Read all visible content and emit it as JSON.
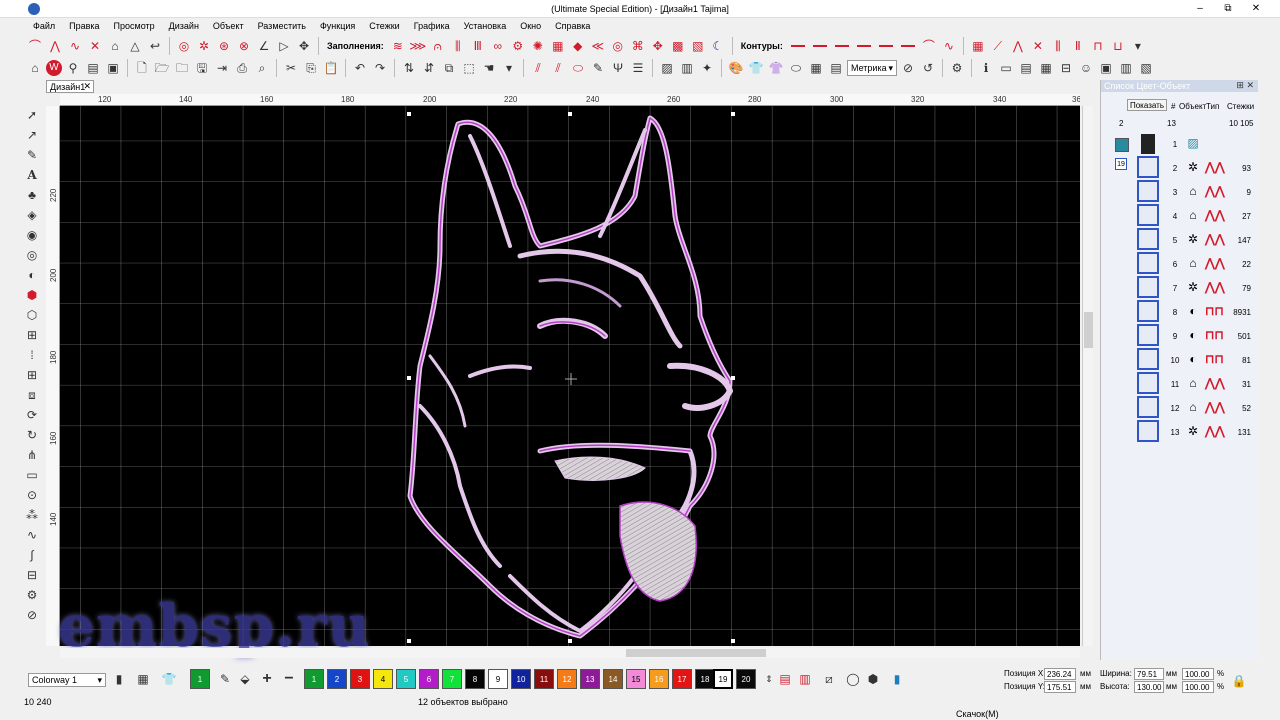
{
  "window": {
    "title": "(Ultimate Special Edition) - [Дизайн1       Tajima]",
    "minimize": "–",
    "restore": "⧉",
    "close": "✕"
  },
  "menu": [
    "Файл",
    "Правка",
    "Просмотр",
    "Дизайн",
    "Объект",
    "Разместить",
    "Функция",
    "Стежки",
    "Графика",
    "Установка",
    "Окно",
    "Справка"
  ],
  "toolbar": {
    "fills_label": "Заполнения:",
    "contours_label": "Контуры:",
    "units_value": "Метрика"
  },
  "document": {
    "tab_label": "Дизайн1",
    "tab_close": "✕",
    "ruler_h_ticks": [
      "120",
      "140",
      "160",
      "180",
      "200",
      "220",
      "240",
      "260",
      "280",
      "300",
      "320",
      "340",
      "36"
    ],
    "ruler_v_ticks": [
      "220",
      "200",
      "180",
      "160",
      "140"
    ]
  },
  "panel": {
    "title": "Список Цвет-Объект",
    "controls": "⊞ ✕",
    "show_button": "Показать",
    "header_left": "2",
    "header_count": "13",
    "header_total": "10 105",
    "col_object": "Объект",
    "col_type": "Тип",
    "col_stitches": "Стежки",
    "col_hash": "#",
    "group_label": "19",
    "rows": [
      {
        "num": "1",
        "stitches": ""
      },
      {
        "num": "2",
        "stitches": "93"
      },
      {
        "num": "3",
        "stitches": "9"
      },
      {
        "num": "4",
        "stitches": "27"
      },
      {
        "num": "5",
        "stitches": "147"
      },
      {
        "num": "6",
        "stitches": "22"
      },
      {
        "num": "7",
        "stitches": "79"
      },
      {
        "num": "8",
        "stitches": "8931"
      },
      {
        "num": "9",
        "stitches": "501"
      },
      {
        "num": "10",
        "stitches": "81"
      },
      {
        "num": "11",
        "stitches": "31"
      },
      {
        "num": "12",
        "stitches": "52"
      },
      {
        "num": "13",
        "stitches": "131"
      }
    ]
  },
  "colorbar": {
    "colorway_value": "Colorway 1",
    "current_chip": "1",
    "chips": [
      {
        "label": "1",
        "color": "#0f9b2f"
      },
      {
        "label": "2",
        "color": "#1545c8"
      },
      {
        "label": "3",
        "color": "#e01313"
      },
      {
        "label": "4",
        "color": "#f5e60b"
      },
      {
        "label": "5",
        "color": "#20c9c1"
      },
      {
        "label": "6",
        "color": "#b51cc9"
      },
      {
        "label": "7",
        "color": "#11e23a"
      },
      {
        "label": "8",
        "color": "#050505"
      },
      {
        "label": "9",
        "color": "#ffffff"
      },
      {
        "label": "10",
        "color": "#10229e"
      },
      {
        "label": "11",
        "color": "#8a0d0d"
      },
      {
        "label": "12",
        "color": "#f47b16"
      },
      {
        "label": "13",
        "color": "#8e1a9a"
      },
      {
        "label": "14",
        "color": "#8a5a24"
      },
      {
        "label": "15",
        "color": "#f28ad8"
      },
      {
        "label": "16",
        "color": "#f59b1e"
      },
      {
        "label": "17",
        "color": "#e31414"
      },
      {
        "label": "18",
        "color": "#0a0a0a"
      },
      {
        "label": "19",
        "color": "#ffffff"
      },
      {
        "label": "20",
        "color": "#0a0a0a"
      }
    ]
  },
  "position": {
    "x_label": "Позиция X:",
    "x_value": "236.24",
    "y_label": "Позиция Y:",
    "y_value": "175.51",
    "unit": "мм",
    "width_label": "Ширина:",
    "width_value": "79.51",
    "height_label": "Высота:",
    "height_value": "130.00",
    "pct_w": "100.00",
    "pct_h": "100.00",
    "pct": "%"
  },
  "status": {
    "stitches": "10 240",
    "selection": "12 объектов выбрано",
    "mode": "Скачок(M)"
  },
  "watermark": "embsp.ru"
}
